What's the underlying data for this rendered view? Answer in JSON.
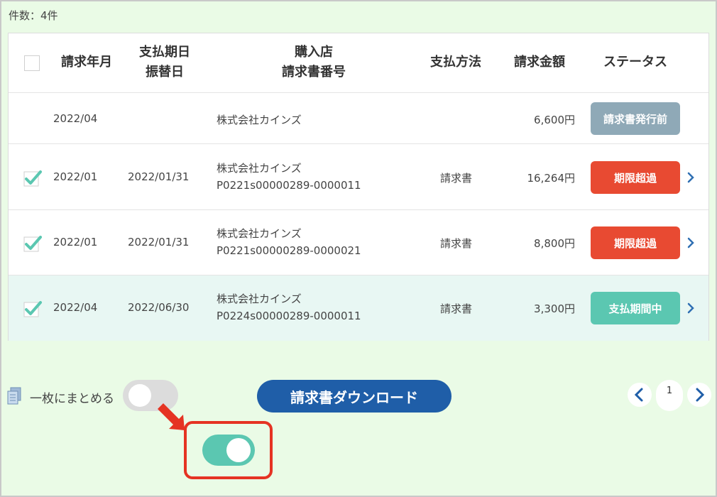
{
  "summary": {
    "count_label": "件数：4件"
  },
  "table": {
    "headers": {
      "month": "請求年月",
      "due_line1": "支払期日",
      "due_line2": "振替日",
      "store_line1": "購入店",
      "store_line2": "請求書番号",
      "method": "支払方法",
      "amount": "請求金額",
      "status": "ステータス"
    },
    "rows": [
      {
        "checked": false,
        "month": "2022/04",
        "due": "",
        "store": "株式会社カインズ",
        "invoice_no": "",
        "method": "",
        "amount": "6,600円",
        "status": "請求書発行前",
        "status_color": "#8fa9b7"
      },
      {
        "checked": true,
        "month": "2022/01",
        "due": "2022/01/31",
        "store": "株式会社カインズ",
        "invoice_no": "P0221s00000289-0000011",
        "method": "請求書",
        "amount": "16,264円",
        "status": "期限超過",
        "status_color": "#e84a32"
      },
      {
        "checked": true,
        "month": "2022/01",
        "due": "2022/01/31",
        "store": "株式会社カインズ",
        "invoice_no": "P0221s00000289-0000021",
        "method": "請求書",
        "amount": "8,800円",
        "status": "期限超過",
        "status_color": "#e84a32"
      },
      {
        "checked": true,
        "month": "2022/04",
        "due": "2022/06/30",
        "store": "株式会社カインズ",
        "invoice_no": "P0224s00000289-0000011",
        "method": "請求書",
        "amount": "3,300円",
        "status": "支払期間中",
        "status_color": "#5bc7b1"
      }
    ]
  },
  "footer": {
    "merge_label": "一枚にまとめる",
    "merge_toggle_on": false,
    "download_label": "請求書ダウンロード",
    "current_page": "1"
  },
  "callout": {
    "toggle_on": true
  },
  "colors": {
    "primary": "#1f5ea8",
    "accent": "#5bc7b1",
    "alert": "#e84a32",
    "highlight": "#e53323"
  },
  "icons": [
    "checkbox-icon",
    "check-icon",
    "chevron-right-icon",
    "documents-icon",
    "chevron-left-icon",
    "arrow-icon"
  ]
}
